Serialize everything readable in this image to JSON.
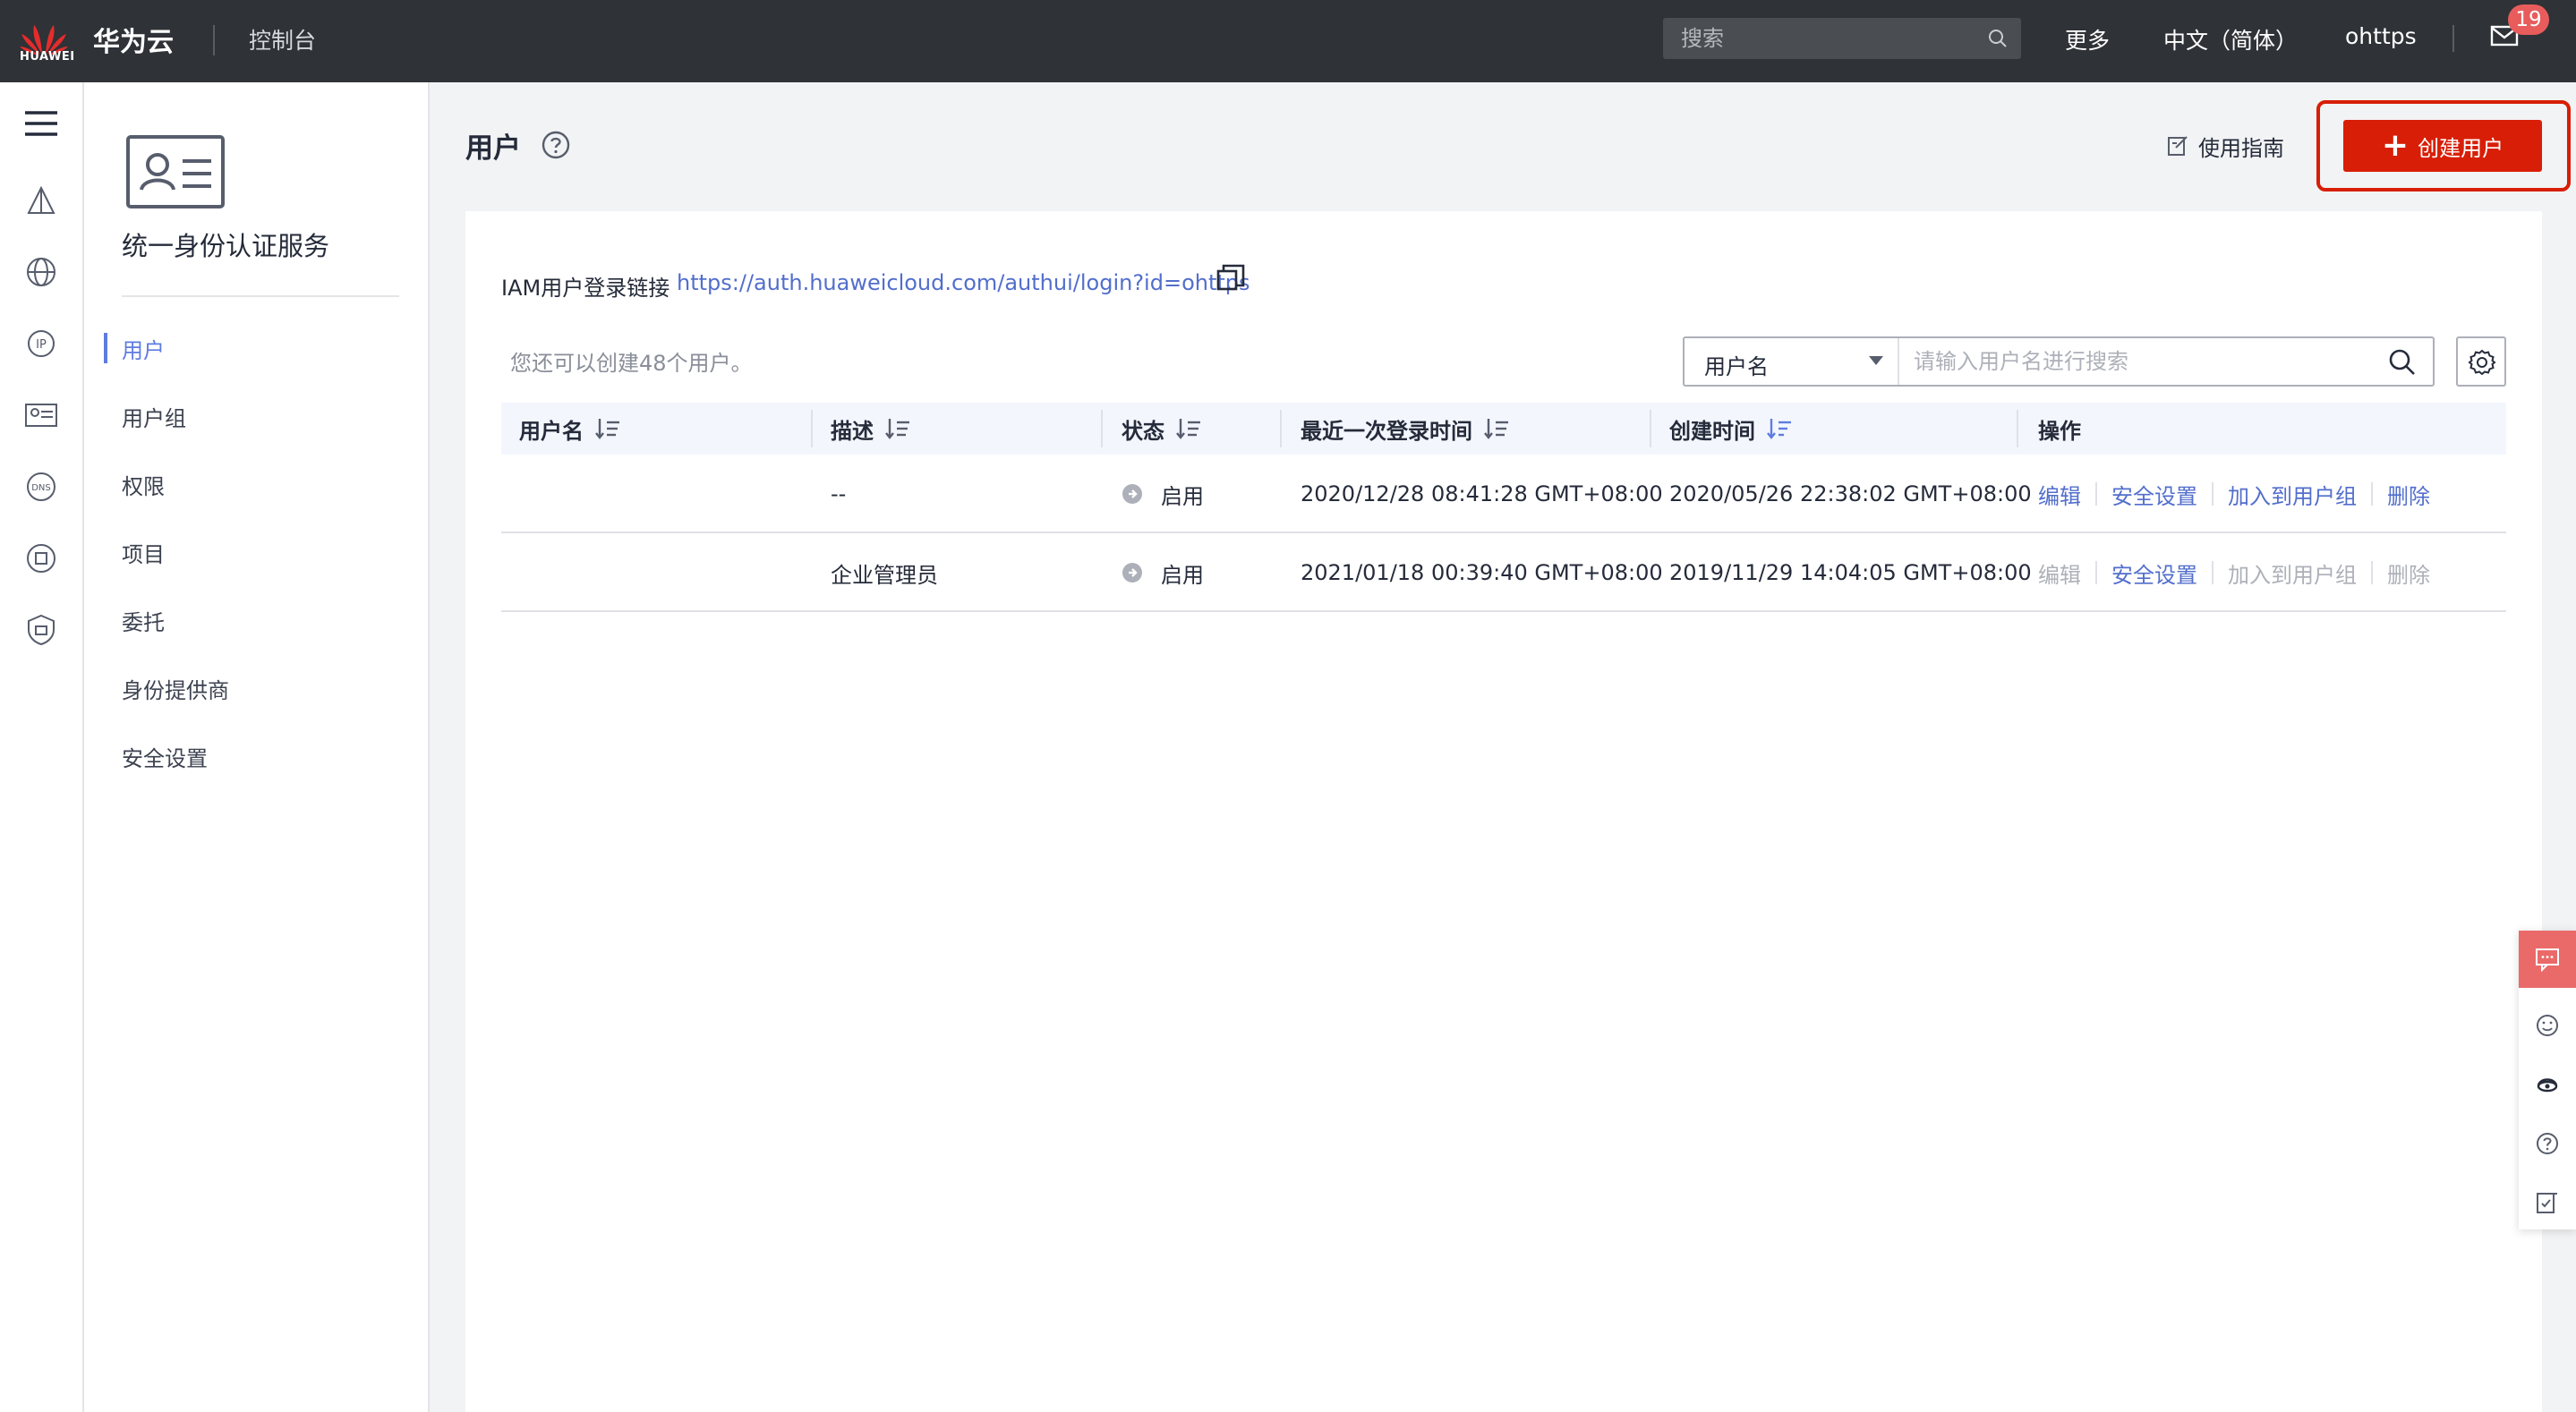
{
  "topbar": {
    "brand_word": "HUAWEI",
    "brand_name": "华为云",
    "console": "控制台",
    "search_placeholder": "搜索",
    "more": "更多",
    "language": "中文（简体）",
    "username": "ohttps",
    "mail_badge": "19",
    "bg_color": "#2f3237"
  },
  "rail": {
    "icons": [
      "menu-icon",
      "sail-icon",
      "globe-icon",
      "ip-icon",
      "id-card-icon",
      "dns-icon",
      "network-icon",
      "shield-icon"
    ]
  },
  "sidebar": {
    "service_title": "统一身份认证服务",
    "items": [
      {
        "label": "用户",
        "active": true
      },
      {
        "label": "用户组"
      },
      {
        "label": "权限"
      },
      {
        "label": "项目"
      },
      {
        "label": "委托"
      },
      {
        "label": "身份提供商"
      },
      {
        "label": "安全设置"
      }
    ],
    "active_color": "#5e7ce0"
  },
  "header": {
    "title": "用户",
    "guide": "使用指南",
    "create_button": "创建用户",
    "accent_color": "#d81e06"
  },
  "content": {
    "login_label": "IAM用户登录链接",
    "login_url": "https://auth.huaweicloud.com/authui/login?id=ohttps",
    "quota_text": "您还可以创建48个用户。",
    "filter_field": "用户名",
    "filter_placeholder": "请输入用户名进行搜索",
    "link_color": "#526ecc"
  },
  "table": {
    "columns": [
      "用户名",
      "描述",
      "状态",
      "最近一次登录时间",
      "创建时间",
      "操作"
    ],
    "rows": [
      {
        "username": "",
        "description": "--",
        "status": "启用",
        "last_login": "2020/12/28 08:41:28 GMT+08:00",
        "created": "2020/05/26 22:38:02 GMT+08:00",
        "ops": [
          "编辑",
          "安全设置",
          "加入到用户组",
          "删除"
        ],
        "ops_enabled": [
          true,
          true,
          true,
          true
        ]
      },
      {
        "username": "",
        "description": "企业管理员",
        "status": "启用",
        "last_login": "2021/01/18 00:39:40 GMT+08:00",
        "created": "2019/11/29 14:04:05 GMT+08:00",
        "ops": [
          "编辑",
          "安全设置",
          "加入到用户组",
          "删除"
        ],
        "ops_enabled": [
          false,
          true,
          false,
          false
        ]
      }
    ]
  },
  "float_tools": [
    "chat-icon",
    "feedback-smile-icon",
    "support-headset-icon",
    "help-icon",
    "survey-icon"
  ]
}
